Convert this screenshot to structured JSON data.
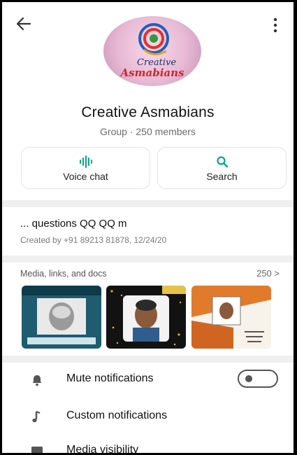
{
  "header": {
    "back_icon": "arrow-left-icon",
    "menu_icon": "more-vertical-icon"
  },
  "group": {
    "logo_text": "Creative Asmabians",
    "name": "Creative Asmabians",
    "subtitle": "Group · 250 members"
  },
  "actions": [
    {
      "label": "Voice chat",
      "icon": "voice-wave-icon"
    },
    {
      "label": "Search",
      "icon": "search-icon"
    }
  ],
  "description": {
    "text": "... questions QQ QQ m",
    "created": "Created by +91 89213 81878, 12/24/20"
  },
  "media": {
    "heading": "Media, links, and docs",
    "count": "250 >"
  },
  "settings": [
    {
      "label": "Mute notifications",
      "icon": "bell-icon",
      "toggle": false
    },
    {
      "label": "Custom notifications",
      "icon": "music-note-icon"
    },
    {
      "label": "Media visibility",
      "icon": "image-icon"
    }
  ],
  "colors": {
    "accent": "#00a884",
    "separator": "#efefef"
  }
}
